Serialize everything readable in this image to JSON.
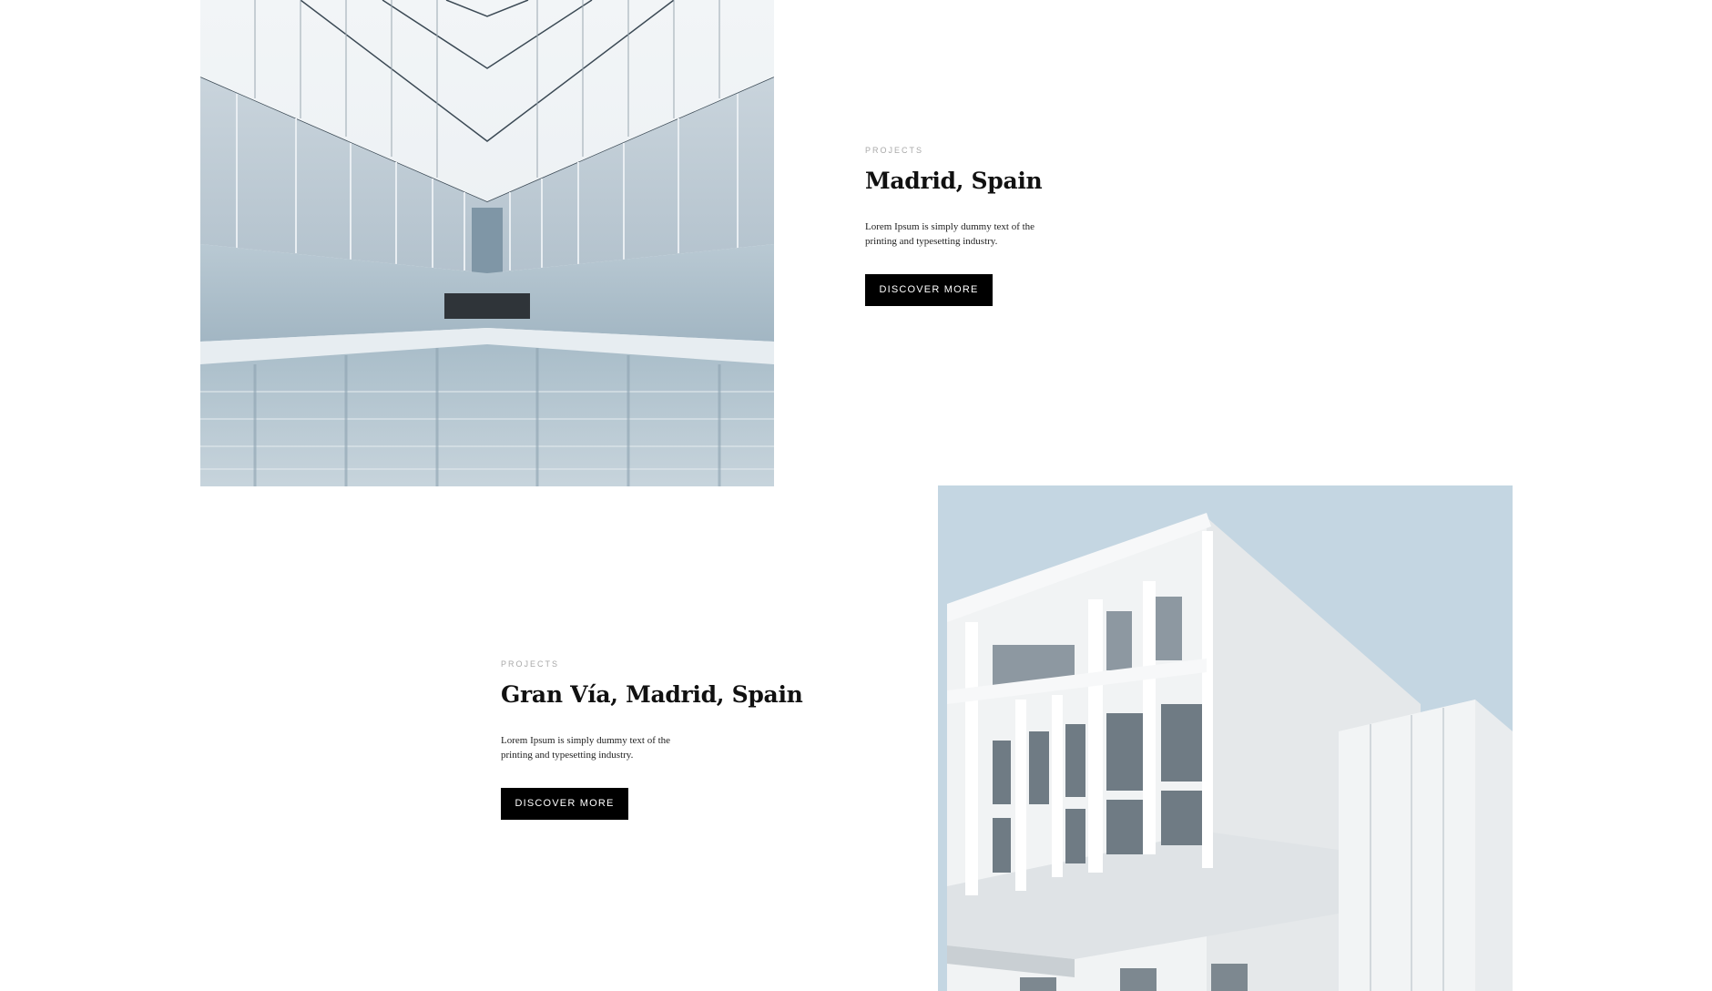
{
  "projects": [
    {
      "eyebrow": "PROJECTS",
      "title": "Madrid, Spain",
      "description": "Lorem Ipsum is simply dummy text of the printing and typesetting industry.",
      "button_label": "DISCOVER MORE"
    },
    {
      "eyebrow": "PROJECTS",
      "title": "Gran Vía, Madrid, Spain",
      "description": "Lorem Ipsum is simply dummy text of the printing and typesetting industry.",
      "button_label": "DISCOVER MORE"
    }
  ],
  "colors": {
    "button_bg": "#000000",
    "eyebrow": "#a9a9a9",
    "sky_blue": "#c4d6e2"
  }
}
